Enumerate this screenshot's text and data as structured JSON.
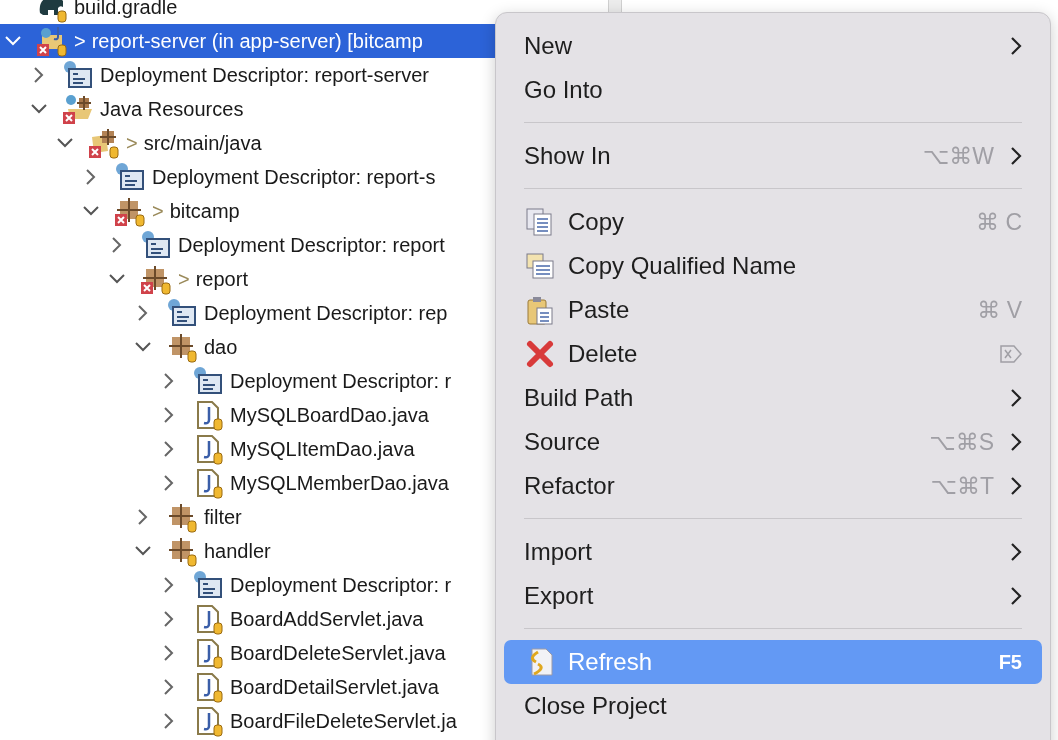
{
  "tree": [
    {
      "label": "build.gradle",
      "kind": "gradle",
      "selected": false,
      "error": false
    },
    {
      "label": "report-server (in app-server) [bitcamp",
      "prefix": ">",
      "kind": "project",
      "expanded": true,
      "selected": true,
      "error": true,
      "children": [
        {
          "label": "Deployment Descriptor: report-server",
          "kind": "descriptor",
          "expanded": false,
          "selected": false,
          "error": false
        },
        {
          "label": "Java Resources",
          "kind": "resources",
          "expanded": true,
          "selected": false,
          "error": true,
          "children": [
            {
              "label": "src/main/java",
              "prefix": ">",
              "kind": "srcfolder",
              "expanded": true,
              "selected": false,
              "error": true,
              "children": [
                {
                  "label": "Deployment Descriptor: report-s",
                  "kind": "descriptor",
                  "expanded": false,
                  "selected": false,
                  "error": false
                },
                {
                  "label": "bitcamp",
                  "prefix": ">",
                  "kind": "package",
                  "expanded": true,
                  "selected": false,
                  "error": true,
                  "children": [
                    {
                      "label": "Deployment Descriptor: report",
                      "kind": "descriptor",
                      "expanded": false,
                      "selected": false,
                      "error": false
                    },
                    {
                      "label": "report",
                      "prefix": ">",
                      "kind": "package",
                      "expanded": true,
                      "selected": false,
                      "error": true,
                      "children": [
                        {
                          "label": "Deployment Descriptor: rep",
                          "kind": "descriptor",
                          "expanded": false,
                          "selected": false,
                          "error": false
                        },
                        {
                          "label": "dao",
                          "kind": "package",
                          "expanded": true,
                          "selected": false,
                          "error": false,
                          "children": [
                            {
                              "label": "Deployment Descriptor: r",
                              "kind": "descriptor",
                              "expanded": false,
                              "selected": false,
                              "error": false
                            },
                            {
                              "label": "MySQLBoardDao.java",
                              "kind": "java",
                              "expanded": false,
                              "selected": false,
                              "error": false
                            },
                            {
                              "label": "MySQLItemDao.java",
                              "kind": "java",
                              "expanded": false,
                              "selected": false,
                              "error": false
                            },
                            {
                              "label": "MySQLMemberDao.java",
                              "kind": "java",
                              "expanded": false,
                              "selected": false,
                              "error": false
                            }
                          ]
                        },
                        {
                          "label": "filter",
                          "kind": "package",
                          "expanded": false,
                          "selected": false,
                          "error": false
                        },
                        {
                          "label": "handler",
                          "kind": "package",
                          "expanded": true,
                          "selected": false,
                          "error": false,
                          "children": [
                            {
                              "label": "Deployment Descriptor: r",
                              "kind": "descriptor",
                              "expanded": false,
                              "selected": false,
                              "error": false
                            },
                            {
                              "label": "BoardAddServlet.java",
                              "kind": "java",
                              "expanded": false,
                              "selected": false,
                              "error": false
                            },
                            {
                              "label": "BoardDeleteServlet.java",
                              "kind": "java",
                              "expanded": false,
                              "selected": false,
                              "error": false
                            },
                            {
                              "label": "BoardDetailServlet.java",
                              "kind": "java",
                              "expanded": false,
                              "selected": false,
                              "error": false
                            },
                            {
                              "label": "BoardFileDeleteServlet.ja",
                              "kind": "java",
                              "expanded": false,
                              "selected": false,
                              "error": false
                            }
                          ]
                        }
                      ]
                    }
                  ]
                }
              ]
            }
          ]
        }
      ]
    }
  ],
  "context_menu": [
    {
      "kind": "plain",
      "label": "New",
      "submenu": true,
      "selected": false
    },
    {
      "kind": "plain",
      "label": "Go Into",
      "submenu": false,
      "selected": false
    },
    {
      "kind": "separator"
    },
    {
      "kind": "plain",
      "label": "Show In",
      "shortcut": "⌥⌘W",
      "submenu": true,
      "selected": false
    },
    {
      "kind": "separator"
    },
    {
      "kind": "copy",
      "label": "Copy",
      "shortcut": "⌘ C",
      "submenu": false,
      "selected": false
    },
    {
      "kind": "copyname",
      "label": "Copy Qualified Name",
      "submenu": false,
      "selected": false
    },
    {
      "kind": "paste",
      "label": "Paste",
      "shortcut": "⌘ V",
      "submenu": false,
      "selected": false
    },
    {
      "kind": "delete",
      "label": "Delete",
      "submenu": false,
      "selected": false
    },
    {
      "kind": "plain",
      "label": "Build Path",
      "submenu": true,
      "selected": false
    },
    {
      "kind": "plain",
      "label": "Source",
      "shortcut": "⌥⌘S",
      "submenu": true,
      "selected": false
    },
    {
      "kind": "plain",
      "label": "Refactor",
      "shortcut": "⌥⌘T",
      "submenu": true,
      "selected": false
    },
    {
      "kind": "separator"
    },
    {
      "kind": "plain",
      "label": "Import",
      "submenu": true,
      "selected": false
    },
    {
      "kind": "plain",
      "label": "Export",
      "submenu": true,
      "selected": false
    },
    {
      "kind": "separator"
    },
    {
      "kind": "refresh",
      "label": "Refresh",
      "shortcut": "F5",
      "submenu": false,
      "selected": true
    },
    {
      "kind": "plain",
      "label": "Close Project",
      "submenu": false,
      "selected": false
    }
  ]
}
